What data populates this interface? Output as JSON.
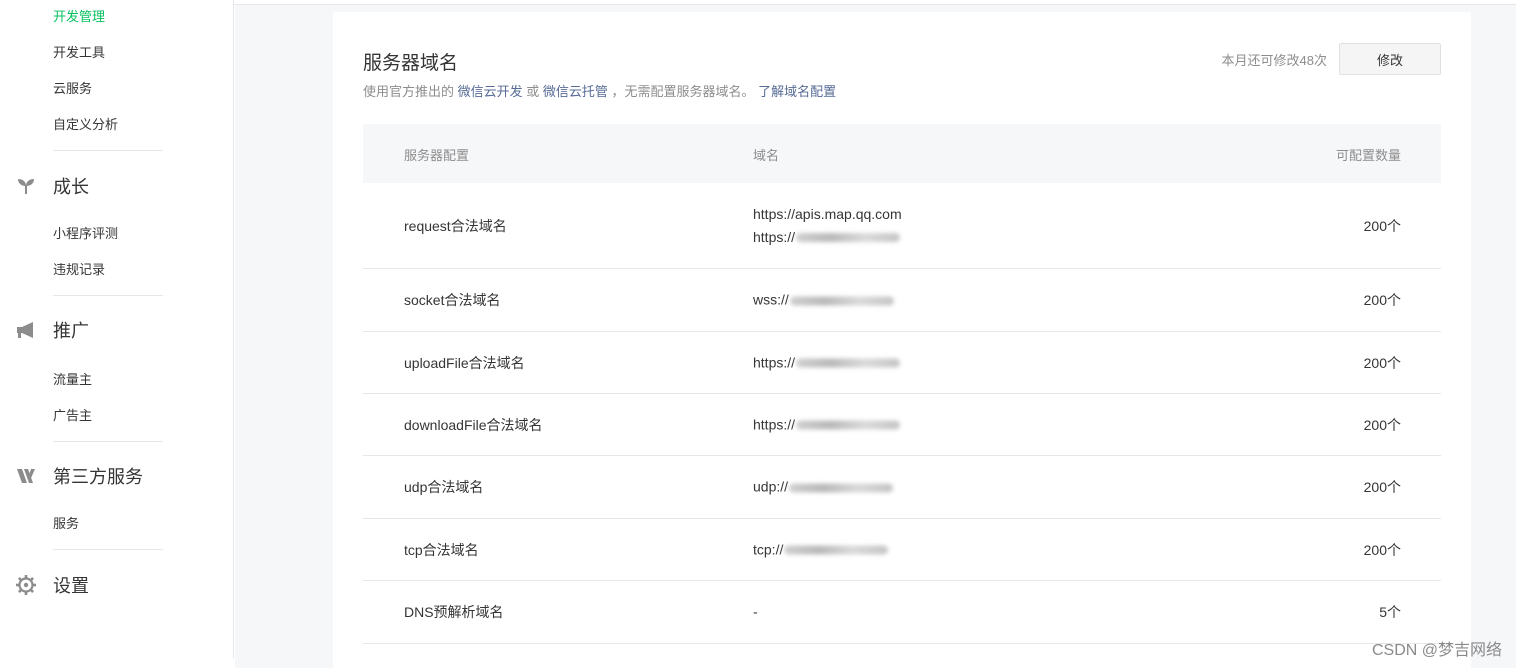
{
  "sidebar": {
    "sub_top": [
      "开发管理",
      "开发工具",
      "云服务",
      "自定义分析"
    ],
    "growth": {
      "label": "成长",
      "items": [
        "小程序评测",
        "违规记录"
      ]
    },
    "promotion": {
      "label": "推广",
      "items": [
        "流量主",
        "广告主"
      ]
    },
    "third_party": {
      "label": "第三方服务",
      "items": [
        "服务"
      ]
    },
    "settings": {
      "label": "设置"
    }
  },
  "panel": {
    "title": "服务器域名",
    "desc_prefix": "使用官方推出的 ",
    "desc_link1": "微信云开发",
    "desc_or": " 或 ",
    "desc_link2": "微信云托管",
    "desc_suffix": " ，无需配置服务器域名。 ",
    "desc_link3": "了解域名配置",
    "quota_text": "本月还可修改48次",
    "modify_label": "修改"
  },
  "table": {
    "headers": [
      "服务器配置",
      "域名",
      "可配置数量"
    ],
    "rows": [
      {
        "name": "request合法域名",
        "domains": [
          "https://apis.map.qq.com",
          "https://"
        ],
        "count": "200个"
      },
      {
        "name": "socket合法域名",
        "domains": [
          "wss://"
        ],
        "count": "200个"
      },
      {
        "name": "uploadFile合法域名",
        "domains": [
          "https://"
        ],
        "count": "200个"
      },
      {
        "name": "downloadFile合法域名",
        "domains": [
          "https://"
        ],
        "count": "200个"
      },
      {
        "name": "udp合法域名",
        "domains": [
          "udp://"
        ],
        "count": "200个"
      },
      {
        "name": "tcp合法域名",
        "domains": [
          "tcp://"
        ],
        "count": "200个"
      },
      {
        "name": "DNS预解析域名",
        "domains": [
          "-"
        ],
        "count": "5个"
      }
    ]
  },
  "watermark": "CSDN @梦吉网络",
  "colors": {
    "accent": "#07c160",
    "link": "#576b95"
  }
}
